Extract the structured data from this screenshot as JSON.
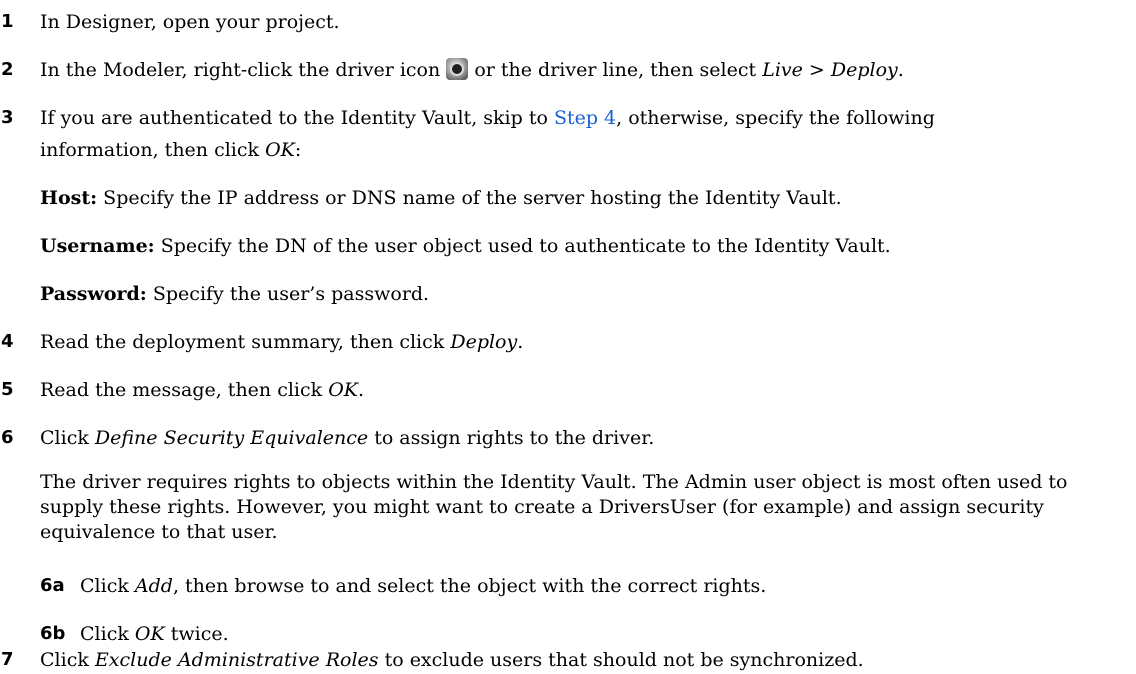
{
  "steps": [
    {
      "num": "1",
      "text": "In Designer, open your project."
    },
    {
      "num": "2",
      "pre": "In the Modeler, right-click the driver icon",
      "icon": "driver-icon",
      "mid": "or the driver line, then select",
      "menu_path": "Live > Deploy",
      "end": "."
    },
    {
      "num": "3",
      "pre": "If you are authenticated to the Identity Vault, skip to",
      "link": "Step 4",
      "post": ", otherwise, specify the following",
      "line2_pre": "information, then click",
      "line2_em": "OK",
      "line2_end": ":"
    },
    {
      "num": "4",
      "pre": "Read the deployment summary, then click",
      "em": "Deploy",
      "end": "."
    },
    {
      "num": "5",
      "pre": "Read the message, then click",
      "em": "OK",
      "end": "."
    },
    {
      "num": "6",
      "pre": "Click",
      "em": "Define Security Equivalence",
      "post": "to assign rights to the driver."
    },
    {
      "num": "7",
      "pre": "Click",
      "em": "Exclude Administrative Roles",
      "post": "to exclude users that should not be synchronized."
    }
  ],
  "fields": [
    {
      "label": "Host:",
      "text": "Specify the IP address or DNS name of the server hosting the Identity Vault."
    },
    {
      "label": "Username:",
      "text": "Specify the DN of the user object used to authenticate to the Identity Vault."
    },
    {
      "label": "Password:",
      "text": "Specify the user’s password."
    }
  ],
  "step6_note": "The driver requires rights to objects within the Identity Vault. The Admin user object is most often used to supply these rights. However, you might want to create a DriversUser (for example) and assign security equivalence to that user.",
  "substeps": [
    {
      "num": "6a",
      "pre": "Click",
      "em": "Add",
      "post": ", then browse to and select the object with the correct rights."
    },
    {
      "num": "6b",
      "pre": "Click",
      "em": "OK",
      "post": "twice."
    }
  ],
  "colors": {
    "link": "#1a5fd6",
    "text": "#000000"
  }
}
